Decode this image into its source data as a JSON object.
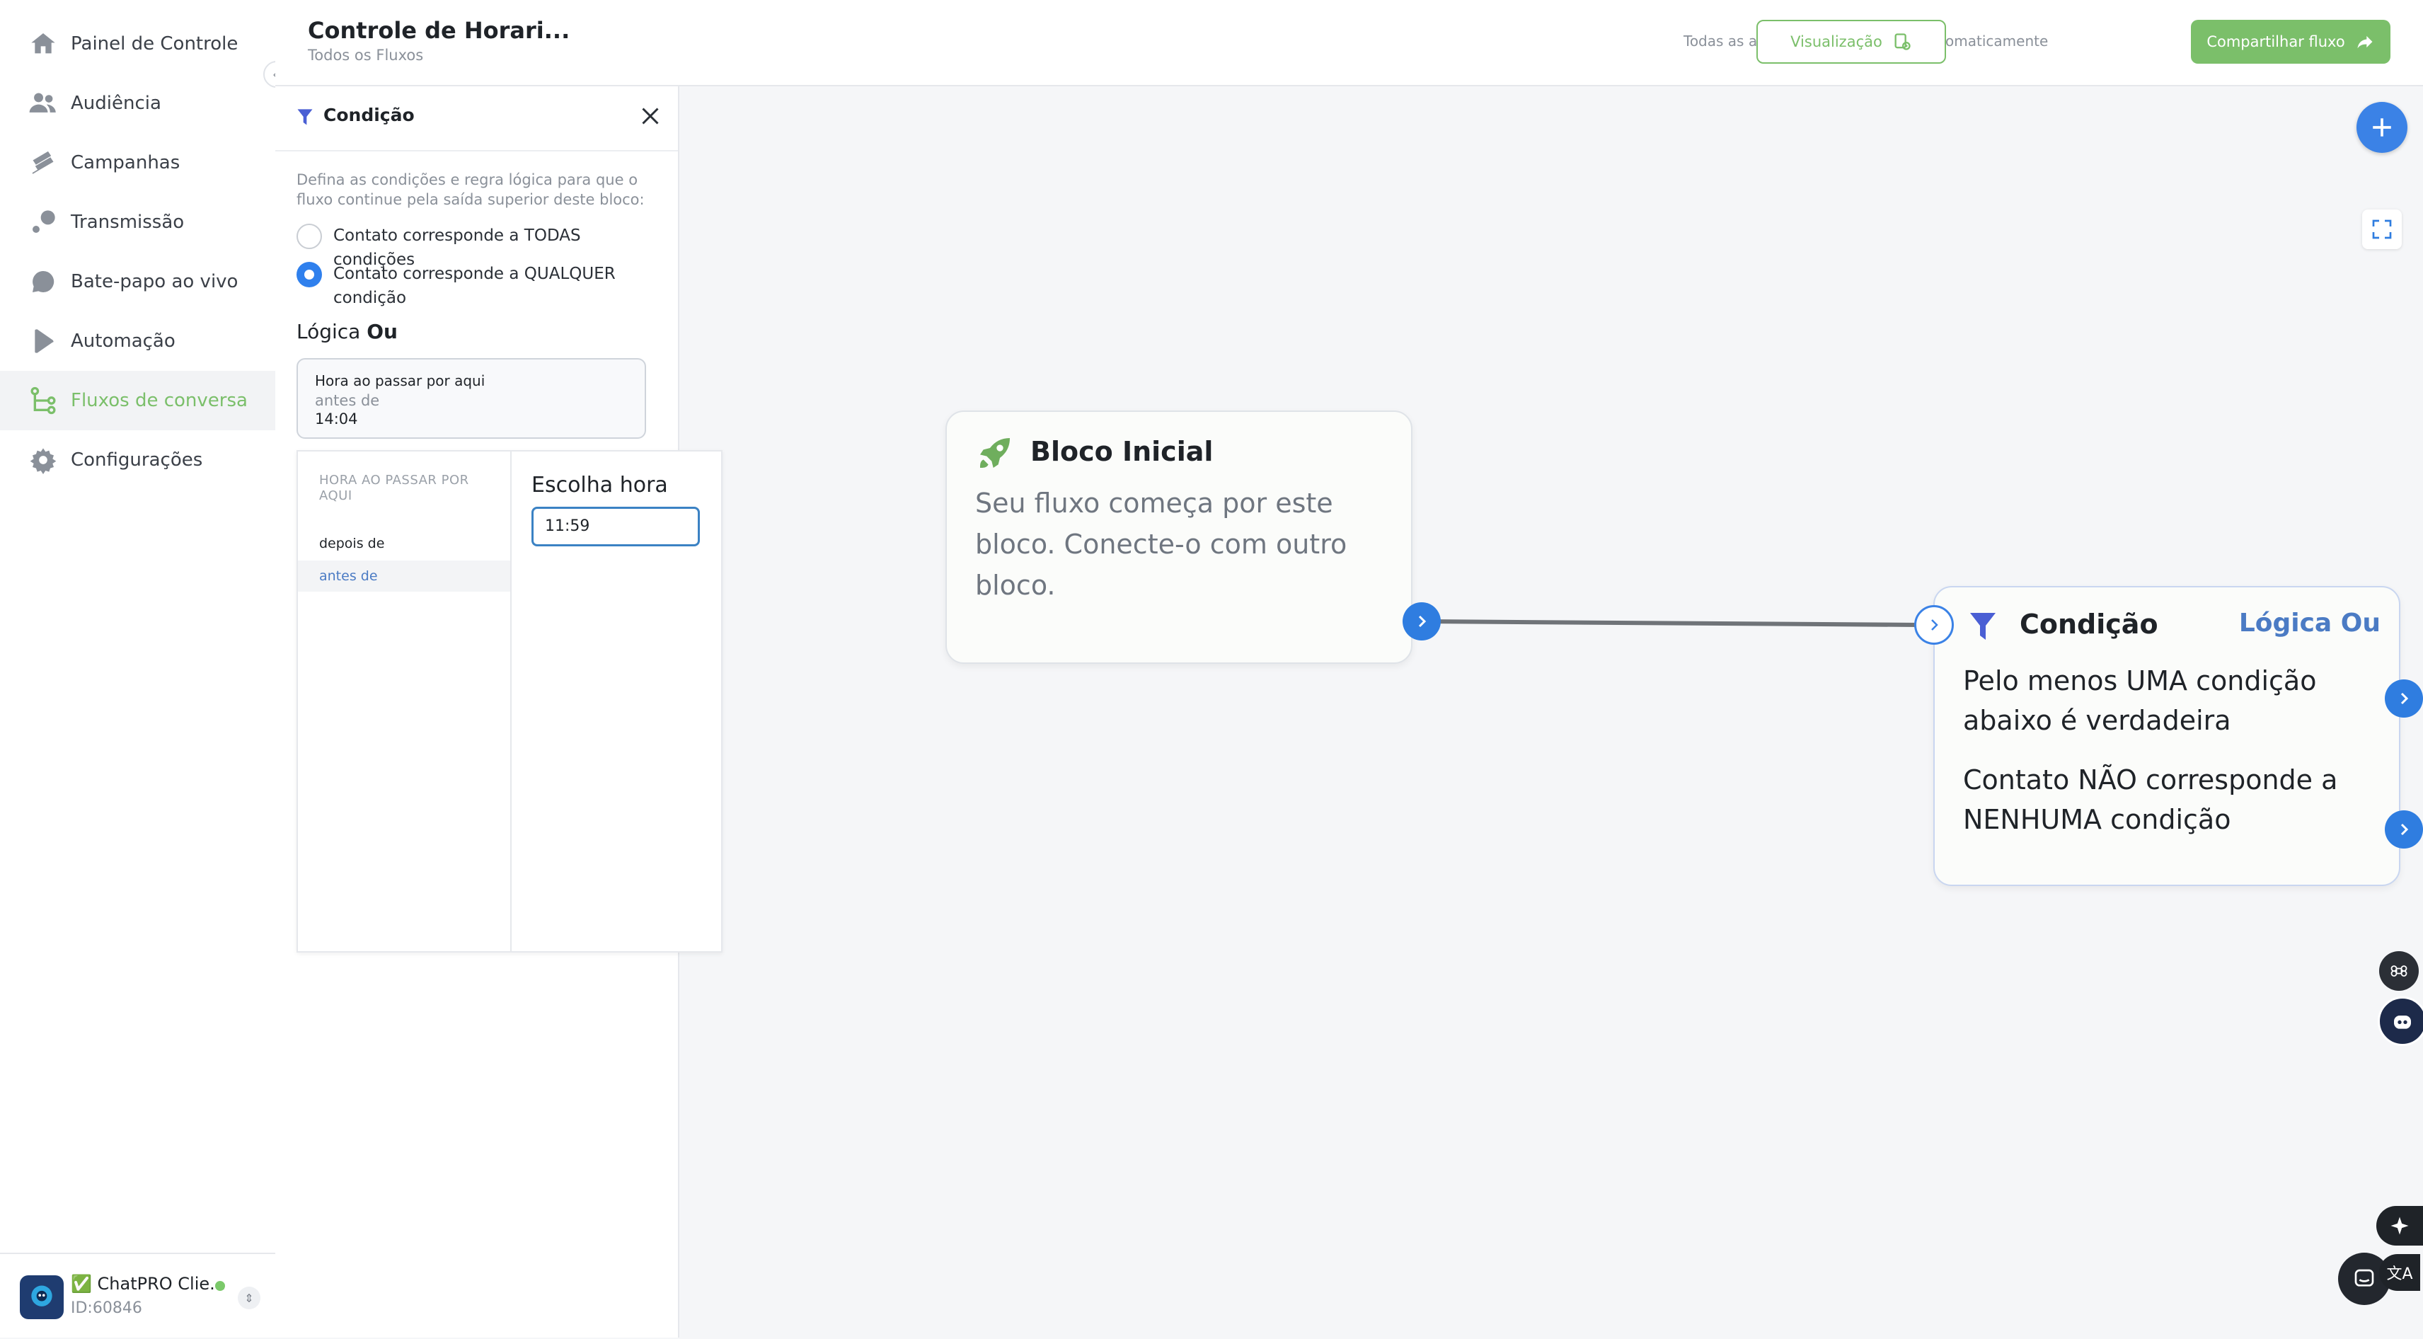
{
  "sidebar": {
    "items": [
      {
        "label": "Painel de Controle",
        "icon": "home-icon"
      },
      {
        "label": "Audiência",
        "icon": "users-icon"
      },
      {
        "label": "Campanhas",
        "icon": "campaign-icon"
      },
      {
        "label": "Transmissão",
        "icon": "broadcast-icon"
      },
      {
        "label": "Bate-papo ao vivo",
        "icon": "chat-bubble-icon"
      },
      {
        "label": "Automação",
        "icon": "automation-icon"
      },
      {
        "label": "Fluxos de conversa",
        "icon": "flow-icon",
        "active": true
      },
      {
        "label": "Configurações",
        "icon": "gear-icon"
      }
    ],
    "account": {
      "name": "✅ ChatPRO Clie...",
      "id": "ID:60846",
      "status_color": "#7bc96a"
    }
  },
  "header": {
    "title": "Controle de Horari...",
    "breadcrumb": "Todos os Fluxos",
    "autosave": "Todas as alterações foram salvas automaticamente",
    "preview_label": "Visualização",
    "share_label": "Compartilhar fluxo"
  },
  "panel": {
    "title": "Condição",
    "description": "Defina as condições e regra lógica para que o fluxo continue pela saída superior deste bloco:",
    "options": [
      {
        "label": "Contato corresponde a TODAS condições",
        "selected": false
      },
      {
        "label": "Contato corresponde a QUALQUER condição",
        "selected": true
      }
    ],
    "logic_prefix": "Lógica",
    "logic_value": "Ou",
    "condition": {
      "title": "Hora ao passar por aqui",
      "operator": "antes de",
      "value": "14:04"
    },
    "picker": {
      "heading": "HORA AO PASSAR POR AQUI",
      "operators": [
        "depois de",
        "antes de"
      ],
      "selected_operator": "antes de",
      "time_label": "Escolha hora",
      "time_value": "11:59"
    }
  },
  "canvas": {
    "start_block": {
      "title": "Bloco Inicial",
      "text": "Seu fluxo começa por este bloco. Conecte-o com outro bloco."
    },
    "condition_block": {
      "title": "Condição",
      "logic": "Lógica Ou",
      "true_text": "Pelo menos UMA condição abaixo é verdadeira",
      "false_text": "Contato NÃO corresponde a NENHUMA condição"
    }
  },
  "colors": {
    "accent_green": "#7bbf6a",
    "accent_blue": "#2f7de0",
    "logic_blue": "#4b7bc4"
  }
}
